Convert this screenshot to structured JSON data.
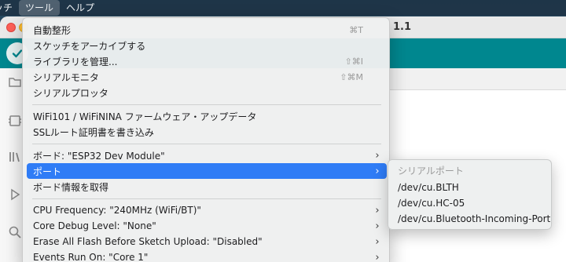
{
  "menubar": {
    "items": [
      "ッチ",
      "ツール",
      "ヘルプ"
    ],
    "active_index": 1
  },
  "window": {
    "title_fragment": "1.1"
  },
  "tools_menu": {
    "items": [
      {
        "label": "自動整形",
        "shortcut": "⌘T"
      },
      {
        "label": "スケッチをアーカイブする"
      },
      {
        "label": "ライブラリを管理...",
        "shortcut": "⇧⌘I"
      },
      {
        "label": "シリアルモニタ",
        "shortcut": "⇧⌘M"
      },
      {
        "label": "シリアルプロッタ"
      },
      {
        "label": "WiFi101 /  WiFiNINA ファームウェア・アップデータ"
      },
      {
        "label": "SSLルート証明書を書き込み"
      },
      {
        "label": "ボード: \"ESP32 Dev Module\"",
        "submenu": true
      },
      {
        "label": "ポート",
        "submenu": true,
        "selected": true
      },
      {
        "label": "ボード情報を取得"
      },
      {
        "label": "CPU Frequency: \"240MHz (WiFi/BT)\"",
        "submenu": true
      },
      {
        "label": "Core Debug Level: \"None\"",
        "submenu": true
      },
      {
        "label": "Erase All Flash Before Sketch Upload: \"Disabled\"",
        "submenu": true
      },
      {
        "label": "Events Run On: \"Core 1\"",
        "submenu": true
      }
    ]
  },
  "port_submenu": {
    "header": "シリアルポート",
    "items": [
      "/dev/cu.BLTH",
      "/dev/cu.HC-05",
      "/dev/cu.Bluetooth-Incoming-Port"
    ]
  },
  "colors": {
    "accent_selection": "#2f7cf6",
    "toolbar_teal": "#00878f"
  },
  "icons": {
    "chevron": "chevron-right-icon",
    "verify": "checkmark-icon"
  }
}
